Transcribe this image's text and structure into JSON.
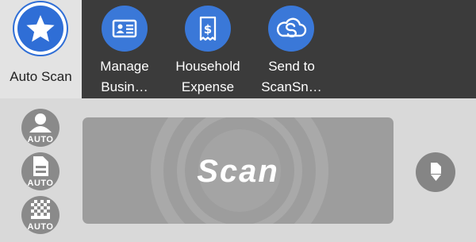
{
  "profiles": [
    {
      "label": "Auto Scan",
      "icon": "star-icon",
      "selected": true
    },
    {
      "label_line1": "Manage",
      "label_line2": "Busin…",
      "icon": "business-card-icon"
    },
    {
      "label_line1": "Household",
      "label_line2": "Expense",
      "icon": "receipt-icon"
    },
    {
      "label_line1": "Send to",
      "label_line2": "ScanSn…",
      "icon": "scansnap-cloud-icon"
    }
  ],
  "modes": [
    {
      "label": "AUTO",
      "icon": "person-auto-icon"
    },
    {
      "label": "AUTO",
      "icon": "document-auto-icon"
    },
    {
      "label": "AUTO",
      "icon": "checker-auto-icon"
    }
  ],
  "scan": {
    "label": "Scan"
  },
  "side_button": {
    "icon": "document-feed-icon"
  },
  "colors": {
    "accent": "#3a78d8",
    "topbar": "#3b3b3b",
    "panel": "#9d9d9d",
    "background": "#d9d9d9"
  }
}
